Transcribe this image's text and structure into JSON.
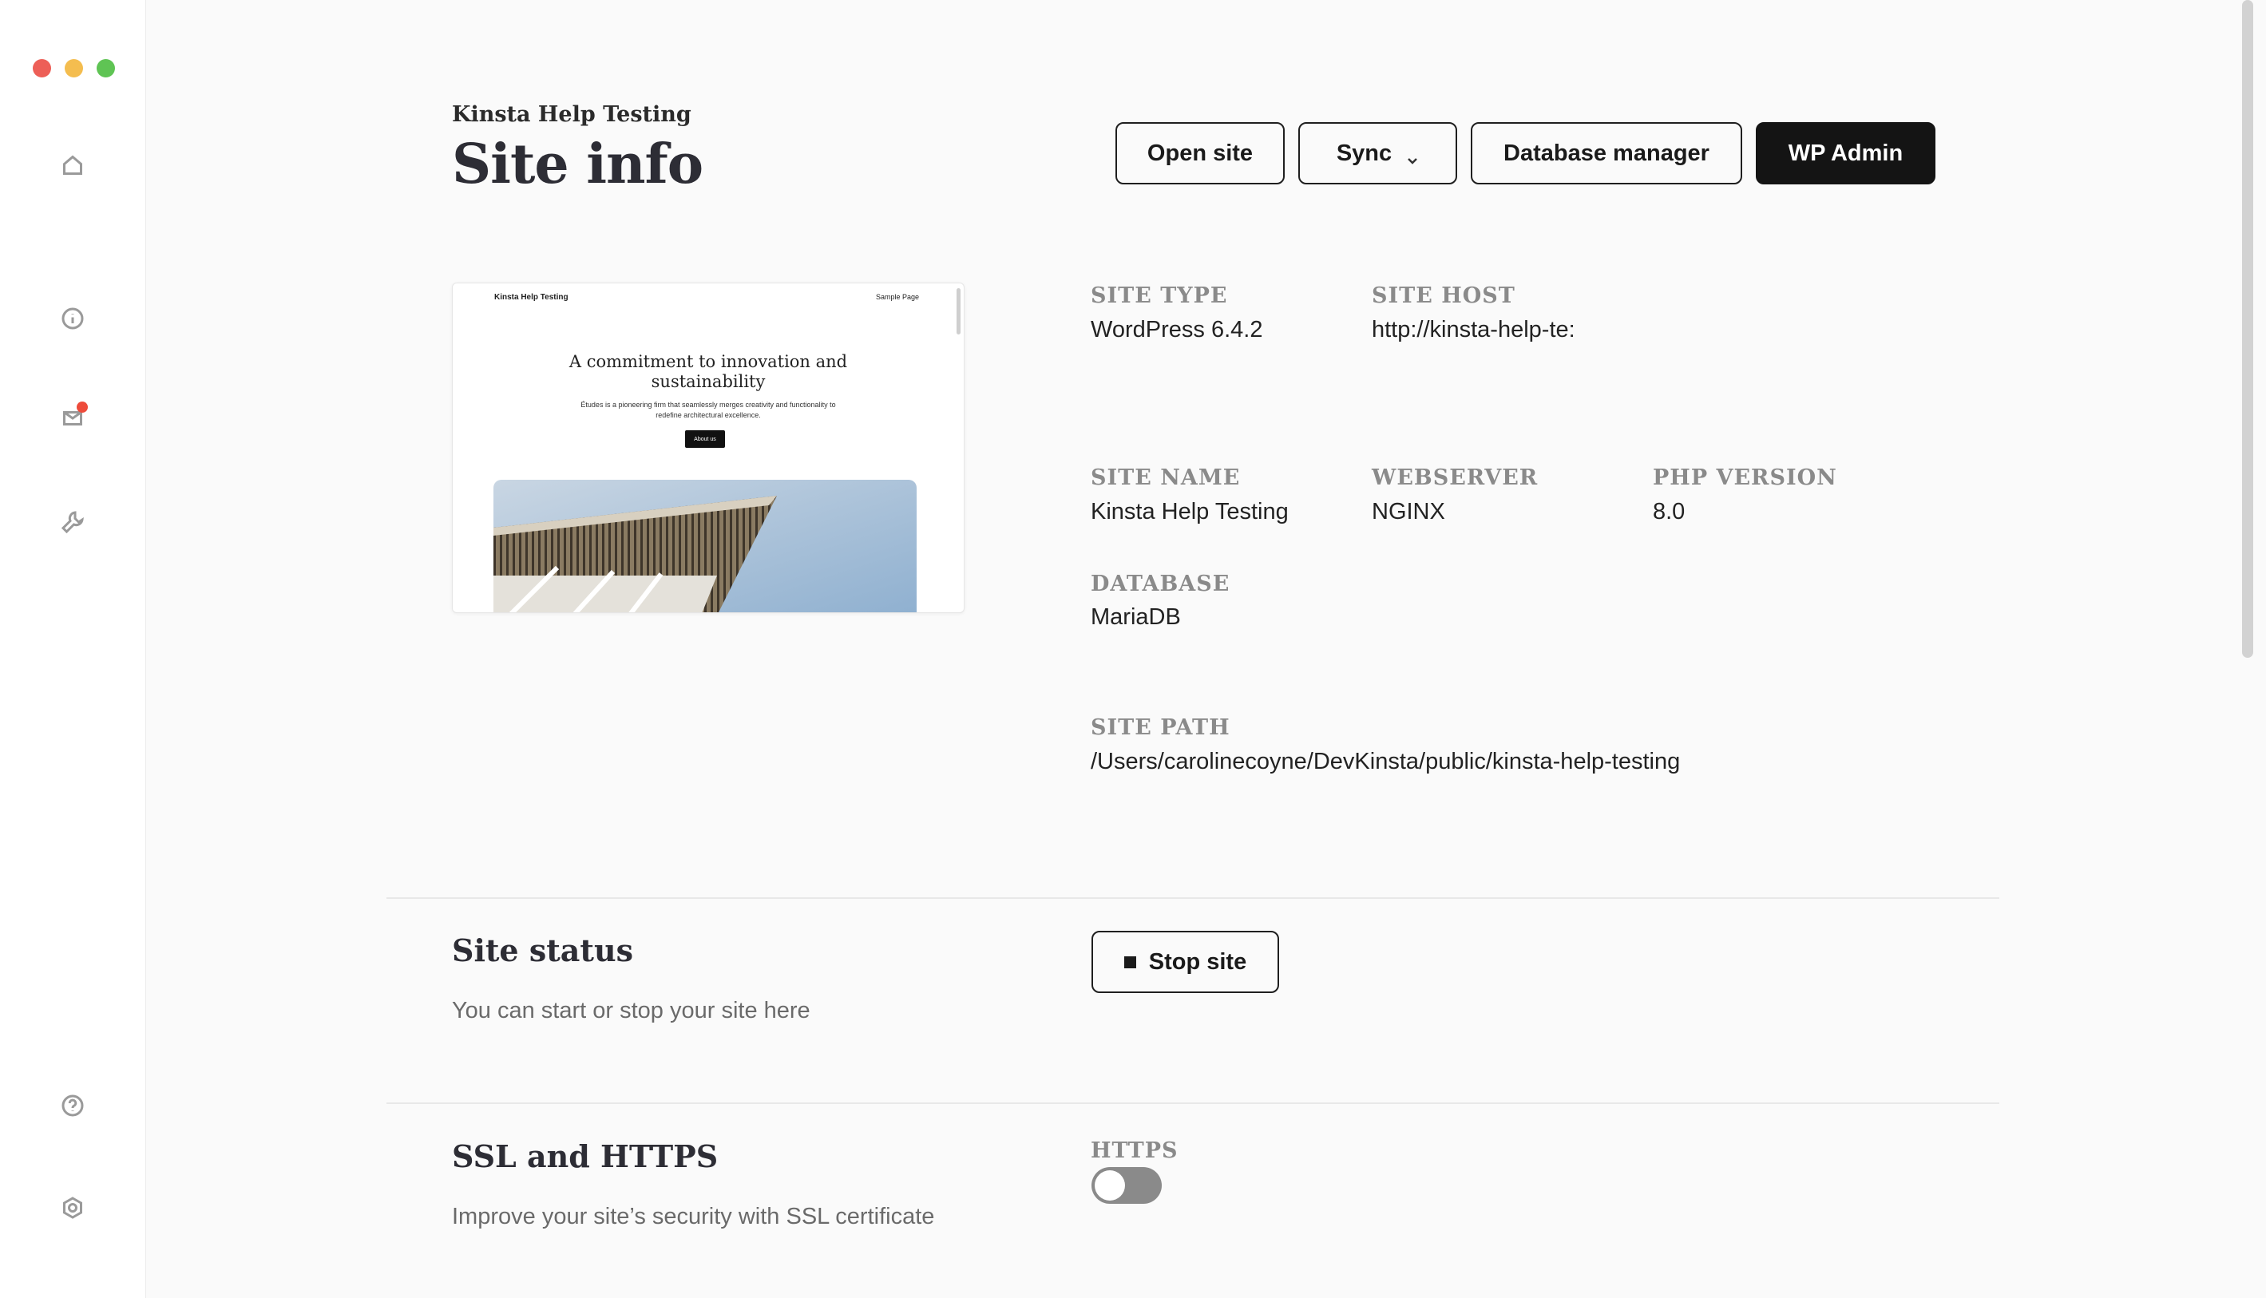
{
  "header": {
    "site_name": "Kinsta Help Testing",
    "title": "Site info"
  },
  "actions": {
    "open_site": "Open site",
    "sync": "Sync",
    "database_manager": "Database manager",
    "wp_admin": "WP Admin"
  },
  "preview": {
    "logo": "Kinsta Help Testing",
    "nav": "Sample Page",
    "heading": "A commitment to innovation and sustainability",
    "text": "Études is a pioneering firm that seamlessly merges creativity and functionality to redefine architectural excellence.",
    "button": "About us"
  },
  "info": {
    "site_type": {
      "label": "SITE TYPE",
      "value": "WordPress 6.4.2"
    },
    "site_host": {
      "label": "SITE HOST",
      "value": "http://kinsta-help-te:"
    },
    "site_name": {
      "label": "SITE NAME",
      "value": "Kinsta Help Testing"
    },
    "webserver": {
      "label": "WEBSERVER",
      "value": "NGINX"
    },
    "php_version": {
      "label": "PHP VERSION",
      "value": "8.0"
    },
    "database": {
      "label": "DATABASE",
      "value": "MariaDB"
    },
    "site_path": {
      "label": "SITE PATH",
      "value": "/Users/carolinecoyne/DevKinsta/public/kinsta-help-testing"
    }
  },
  "site_status": {
    "title": "Site status",
    "description": "You can start or stop your site here",
    "stop_button": "Stop site"
  },
  "ssl": {
    "title": "SSL and HTTPS",
    "description": "Improve your site’s security with SSL certificate",
    "https_label": "HTTPS",
    "https_enabled": false
  },
  "sidebar": {
    "icons": [
      "home-icon",
      "info-icon",
      "mail-icon",
      "tools-icon",
      "help-icon",
      "settings-icon"
    ],
    "mail_badge_color": "#ee4b3b"
  }
}
